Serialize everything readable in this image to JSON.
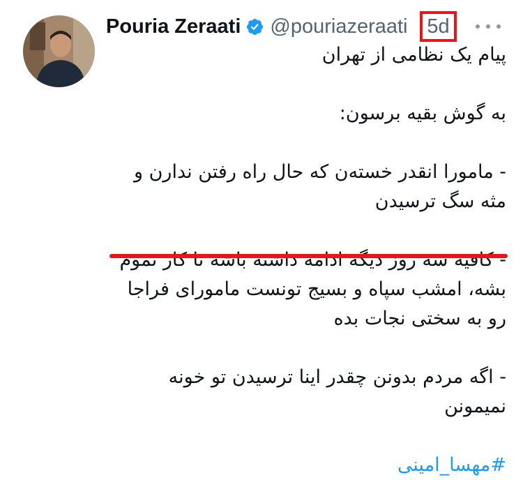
{
  "tweet": {
    "author": {
      "display_name": "Pouria Zeraati",
      "handle": "@pouriazeraati",
      "verified": true
    },
    "time": "5d",
    "lines": [
      "پیام یک نظامی از تهران",
      "",
      "به گوش بقیه برسون:",
      "",
      "- مامورا انقدر خسته‌ن که حال راه رفتن ندارن و",
      "مثه سگ ترسیدن",
      "",
      "- کافیه سه روز دیگه ادامه داشته باشه تا کار تموم",
      "بشه، امشب سپاه و بسیج تونست مامورای فراجا",
      "رو به سختی نجات بده",
      "",
      "- اگه مردم بدونن چقدر اینا ترسیدن تو خونه",
      "نمیمونن",
      ""
    ],
    "hashtag": "#مهسا_امینی"
  },
  "colors": {
    "annotation": "#e8161c",
    "verified_badge": "#1d9bf0",
    "hashtag": "#1d9bf0",
    "secondary_text": "#536471"
  },
  "icons": {
    "verified": "verified-badge-icon",
    "more": "more-options-icon"
  }
}
